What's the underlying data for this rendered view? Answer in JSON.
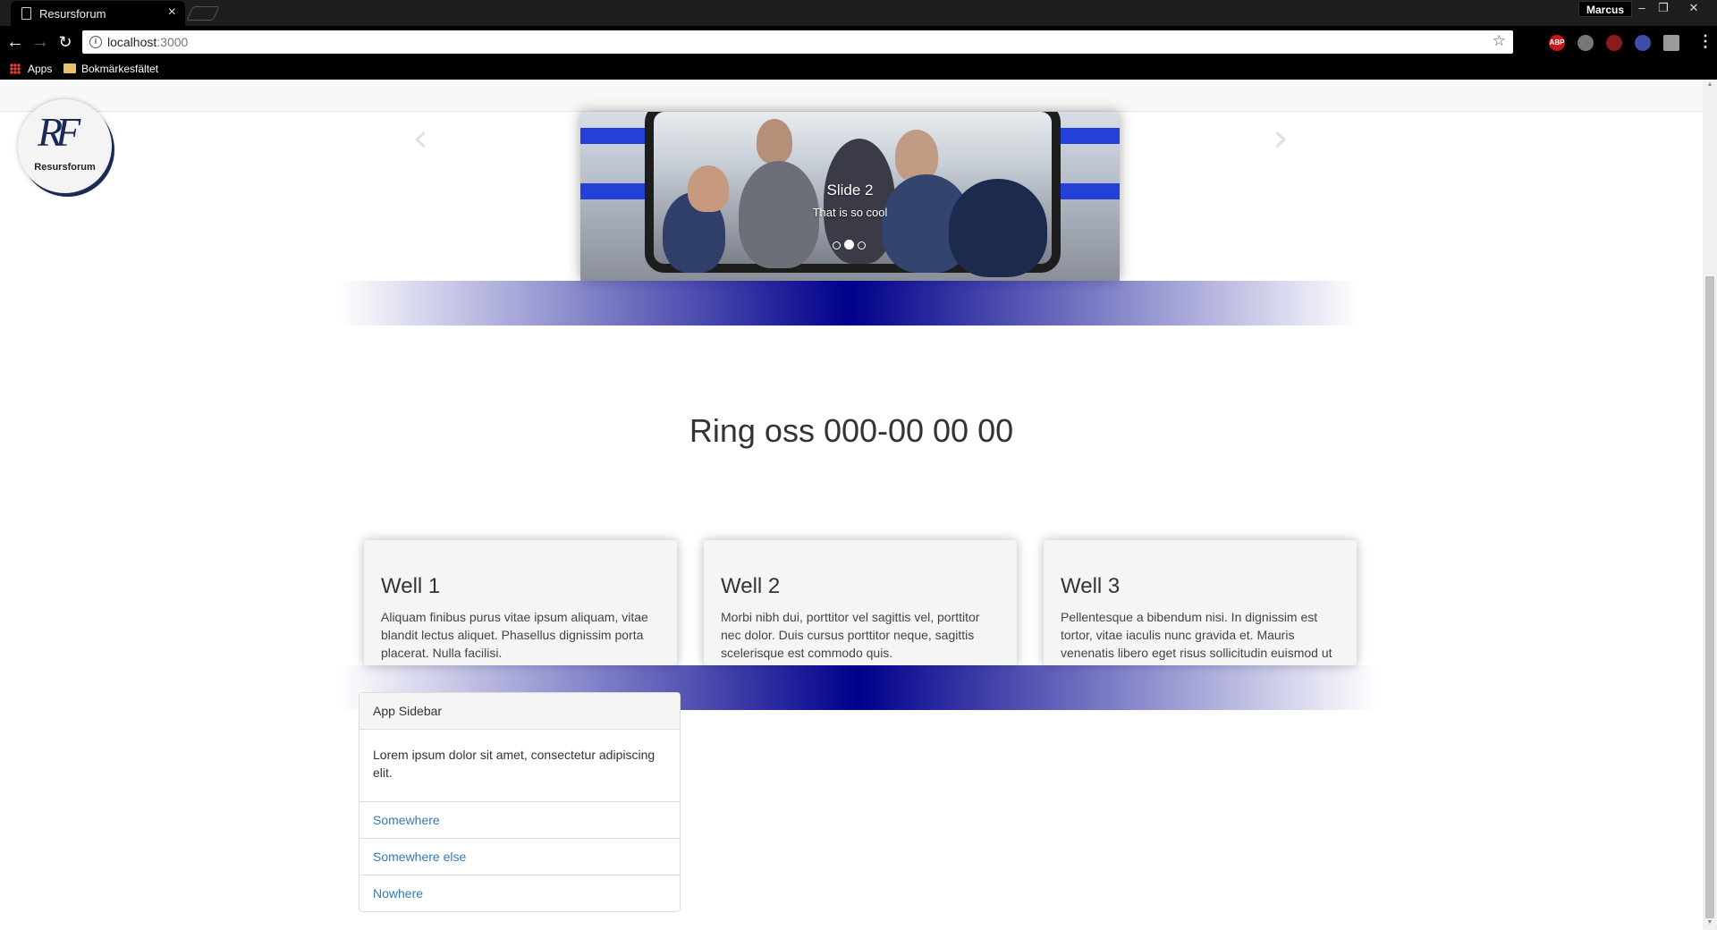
{
  "browser": {
    "tab_title": "Resursforum",
    "tab_close": "×",
    "profile_name": "Marcus",
    "window_buttons": [
      "–",
      "❐",
      "✕"
    ],
    "url_host": "localhost",
    "url_port": ":3000",
    "bookmarks": {
      "apps_label": "Apps",
      "folder_label": "Bokmärkesfältet"
    },
    "extensions": [
      {
        "name": "adblock-icon",
        "label": "ABP",
        "color": "#c7171b"
      },
      {
        "name": "lightbulb-icon",
        "label": "",
        "color": "#777777"
      },
      {
        "name": "ext-red-icon",
        "label": "",
        "color": "#8b1a1a"
      },
      {
        "name": "flag-icon",
        "label": "",
        "color": "#3b4fa8"
      },
      {
        "name": "ext-grey-icon",
        "label": "",
        "color": "#9a9a9a"
      }
    ]
  },
  "page": {
    "logo_text": "Resursforum",
    "logo_monogram": "RF",
    "carousel": {
      "slide_title": "Slide 2",
      "slide_text": "That is so cool",
      "indicator_count": 3,
      "active_index": 1,
      "prev_glyph": "‹",
      "next_glyph": "›"
    },
    "phone_heading": "Ring oss 000-00 00 00",
    "wells": [
      {
        "title": "Well 1",
        "text": "Aliquam finibus purus vitae ipsum aliquam, vitae blandit lectus aliquet. Phasellus dignissim porta placerat. Nulla facilisi."
      },
      {
        "title": "Well 2",
        "text": "Morbi nibh dui, porttitor vel sagittis vel, porttitor nec dolor. Duis cursus porttitor neque, sagittis scelerisque est commodo quis."
      },
      {
        "title": "Well 3",
        "text": "Pellentesque a bibendum nisi. In dignissim est tortor, vitae iaculis nunc gravida et. Mauris venenatis libero eget risus sollicitudin euismod ut"
      }
    ],
    "sidebar": {
      "heading": "App Sidebar",
      "body": "Lorem ipsum dolor sit amet, consectetur adipiscing elit.",
      "links": [
        "Somewhere",
        "Somewhere else",
        "Nowhere"
      ]
    }
  },
  "colors": {
    "band_center": "#00008b",
    "link": "#337ab7",
    "logo_navy": "#1b2a55"
  }
}
